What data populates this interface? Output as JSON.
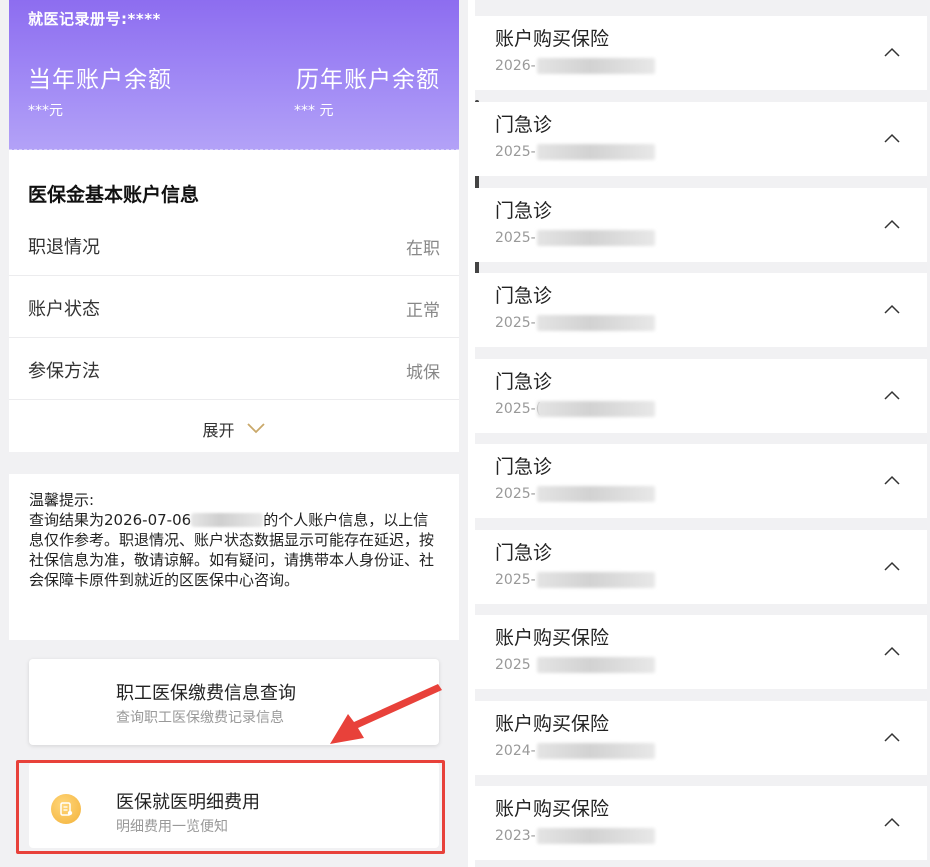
{
  "left": {
    "header": {
      "record_no": "就医记录册号:****",
      "current_balance_label": "当年账户余额",
      "current_balance_value": "***元",
      "history_balance_label": "历年账户余额",
      "history_balance_value": "*** 元"
    },
    "account_info": {
      "title": "医保金基本账户信息",
      "rows": [
        {
          "key": "职退情况",
          "value": "在职"
        },
        {
          "key": "账户状态",
          "value": "正常"
        },
        {
          "key": "参保方法",
          "value": "城保"
        }
      ],
      "expand_label": "展开"
    },
    "tip": {
      "heading": "温馨提示:",
      "body_prefix": "查询结果为2026-07-06",
      "body_suffix": "的个人账户信息，以上信息仅作参考。职退情况、账户状态数据显示可能存在延迟，按社保信息为准，敬请谅解。如有疑问，请携带本人身份证、社会保障卡原件到就近的区医保中心咨询。"
    },
    "services": [
      {
        "title": "职工医保缴费信息查询",
        "subtitle": "查询职工医保缴费记录信息"
      },
      {
        "title": "医保就医明细费用",
        "subtitle": "明细费用一览便知"
      }
    ],
    "colors": {
      "accent": "#8d6df0",
      "highlight": "#e8413a",
      "icon": "#f3b23a"
    }
  },
  "right": {
    "records": [
      {
        "name": "账户购买保险",
        "date": "2026-"
      },
      {
        "name": "门急诊",
        "date": "2025-"
      },
      {
        "name": "门急诊",
        "date": "2025-"
      },
      {
        "name": "门急诊",
        "date": "2025-"
      },
      {
        "name": "门急诊",
        "date": "2025-("
      },
      {
        "name": "门急诊",
        "date": "2025-"
      },
      {
        "name": "门急诊",
        "date": "2025-"
      },
      {
        "name": "账户购买保险",
        "date": "2025"
      },
      {
        "name": "账户购买保险",
        "date": "2024-"
      },
      {
        "name": "账户购买保险",
        "date": "2023-"
      }
    ],
    "chevron_icon": "chevron-up-icon"
  }
}
